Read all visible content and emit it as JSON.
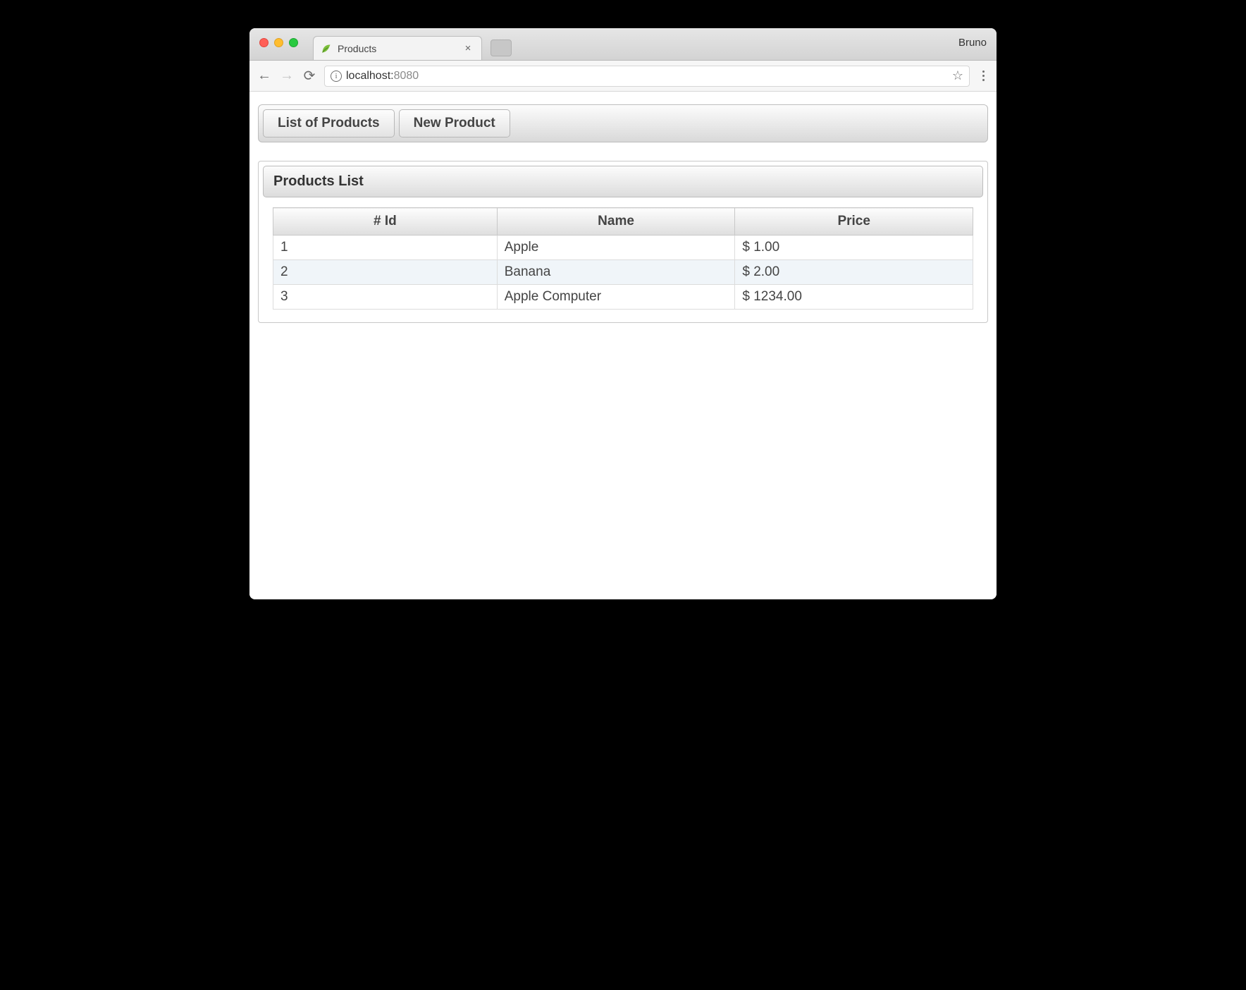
{
  "browser": {
    "tab_title": "Products",
    "profile": "Bruno",
    "url_host": "localhost:",
    "url_port": "8080"
  },
  "menu": {
    "list_label": "List of Products",
    "new_label": "New Product"
  },
  "panel": {
    "title": "Products List"
  },
  "table": {
    "headers": {
      "id": "# Id",
      "name": "Name",
      "price": "Price"
    },
    "rows": [
      {
        "id": "1",
        "name": "Apple",
        "price": "$ 1.00"
      },
      {
        "id": "2",
        "name": "Banana",
        "price": "$ 2.00"
      },
      {
        "id": "3",
        "name": "Apple Computer",
        "price": "$ 1234.00"
      }
    ]
  }
}
